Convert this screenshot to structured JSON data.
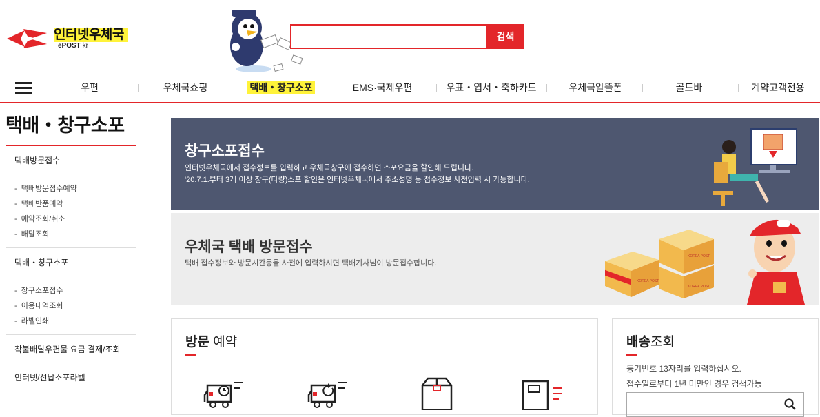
{
  "header": {
    "logo_title": "인터넷우체국",
    "logo_sub_bold": "ePOST",
    "logo_sub_rest": " kr",
    "search_placeholder": "",
    "search_button": "검색"
  },
  "gnb": {
    "items": [
      {
        "label": "우편"
      },
      {
        "label": "우체국쇼핑"
      },
      {
        "label": "택배・창구소포",
        "active": true
      },
      {
        "label": "EMS·국제우편"
      },
      {
        "label": "우표・엽서・축하카드"
      },
      {
        "label": "우체국알뜰폰"
      },
      {
        "label": "골드바"
      },
      {
        "label": "계약고객전용"
      }
    ]
  },
  "lnb": {
    "title": "택배・창구소포",
    "groups": [
      {
        "label": "택배방문접수",
        "subs": [
          "택배방문접수예약",
          "택배반품예약",
          "예약조회/취소",
          "배달조회"
        ]
      },
      {
        "label": "택배・창구소포",
        "subs": [
          "창구소포접수",
          "이용내역조회",
          "라벨인쇄"
        ]
      },
      {
        "label": "착불배달우편물 요금 결제/조회",
        "subs": []
      },
      {
        "label": "인터넷/선납소포라벨",
        "subs": []
      }
    ]
  },
  "banner1": {
    "title": "창구소포접수",
    "desc_line1": "인터넷우체국에서 접수정보를 입력하고 우체국창구에 접수하면 소포요금을 할인해 드립니다.",
    "desc_line2": "'20.7.1.부터 3개 이상 창구(다량)소포 할인은 인터넷우체국에서 주소성명 등 접수정보 사전입력 시 가능합니다."
  },
  "banner2": {
    "title": "우체국 택배 방문접수",
    "desc": "택배 접수정보와 방문시간등을 사전에 입력하시면 택배기사님이 방문접수합니다.",
    "box_label": "KOREA POST"
  },
  "visit_card": {
    "title_bold": "방문",
    "title_rest": " 예약"
  },
  "track_card": {
    "title_bold": "배송",
    "title_rest": "조회",
    "desc_line1": "등기번호 13자리를 입력하십시오.",
    "desc_line2": "접수일로부터 1년 미만인 경우 검색가능"
  },
  "colors": {
    "accent_red": "#e3262a",
    "highlight_yellow": "#fff33a",
    "banner_navy": "#4e5770",
    "banner_gray": "#ededed"
  }
}
